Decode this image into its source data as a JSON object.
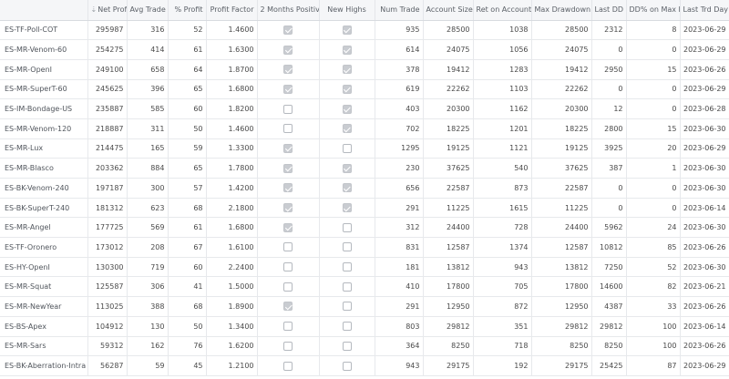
{
  "columns": [
    {
      "label": "Net Profit",
      "sort": "sort-desc-icon"
    },
    {
      "label": "Avg Trade"
    },
    {
      "label": "% Profit"
    },
    {
      "label": "Profit Factor"
    },
    {
      "label": "2 Months Positive"
    },
    {
      "label": "New Highs"
    },
    {
      "label": "Num Trade"
    },
    {
      "label": "Account Size"
    },
    {
      "label": "Ret on Account"
    },
    {
      "label": "Max Drawdown"
    },
    {
      "label": "Last DD"
    },
    {
      "label": "DD% on Max DD"
    },
    {
      "label": "Last Trd Day"
    }
  ],
  "rows": [
    {
      "name": "ES-TF-Poll-COT",
      "net_profit": "295987",
      "avg_trade": "316",
      "pct_profit": "52",
      "profit_factor": "1.4600",
      "two_months_positive": true,
      "new_highs": true,
      "num_trade": "935",
      "account_size": "28500",
      "ret_on_account": "1038",
      "max_drawdown": "28500",
      "last_dd": "2312",
      "dd_pct": "8",
      "last_trd_day": "2023-06-29"
    },
    {
      "name": "ES-MR-Venom-60",
      "net_profit": "254275",
      "avg_trade": "414",
      "pct_profit": "61",
      "profit_factor": "1.6300",
      "two_months_positive": true,
      "new_highs": true,
      "num_trade": "614",
      "account_size": "24075",
      "ret_on_account": "1056",
      "max_drawdown": "24075",
      "last_dd": "0",
      "dd_pct": "0",
      "last_trd_day": "2023-06-29"
    },
    {
      "name": "ES-MR-OpenI",
      "net_profit": "249100",
      "avg_trade": "658",
      "pct_profit": "64",
      "profit_factor": "1.8700",
      "two_months_positive": true,
      "new_highs": true,
      "num_trade": "378",
      "account_size": "19412",
      "ret_on_account": "1283",
      "max_drawdown": "19412",
      "last_dd": "2950",
      "dd_pct": "15",
      "last_trd_day": "2023-06-26"
    },
    {
      "name": "ES-MR-SuperT-60",
      "net_profit": "245625",
      "avg_trade": "396",
      "pct_profit": "65",
      "profit_factor": "1.6800",
      "two_months_positive": true,
      "new_highs": true,
      "num_trade": "619",
      "account_size": "22262",
      "ret_on_account": "1103",
      "max_drawdown": "22262",
      "last_dd": "0",
      "dd_pct": "0",
      "last_trd_day": "2023-06-29"
    },
    {
      "name": "ES-IM-Bondage-US",
      "net_profit": "235887",
      "avg_trade": "585",
      "pct_profit": "60",
      "profit_factor": "1.8200",
      "two_months_positive": false,
      "new_highs": true,
      "num_trade": "403",
      "account_size": "20300",
      "ret_on_account": "1162",
      "max_drawdown": "20300",
      "last_dd": "12",
      "dd_pct": "0",
      "last_trd_day": "2023-06-28"
    },
    {
      "name": "ES-MR-Venom-120",
      "net_profit": "218887",
      "avg_trade": "311",
      "pct_profit": "50",
      "profit_factor": "1.4600",
      "two_months_positive": false,
      "new_highs": true,
      "num_trade": "702",
      "account_size": "18225",
      "ret_on_account": "1201",
      "max_drawdown": "18225",
      "last_dd": "2800",
      "dd_pct": "15",
      "last_trd_day": "2023-06-30"
    },
    {
      "name": "ES-MR-Lux",
      "net_profit": "214475",
      "avg_trade": "165",
      "pct_profit": "59",
      "profit_factor": "1.3300",
      "two_months_positive": true,
      "new_highs": false,
      "num_trade": "1295",
      "account_size": "19125",
      "ret_on_account": "1121",
      "max_drawdown": "19125",
      "last_dd": "3925",
      "dd_pct": "20",
      "last_trd_day": "2023-06-29"
    },
    {
      "name": "ES-MR-Blasco",
      "net_profit": "203362",
      "avg_trade": "884",
      "pct_profit": "65",
      "profit_factor": "1.7800",
      "two_months_positive": true,
      "new_highs": true,
      "num_trade": "230",
      "account_size": "37625",
      "ret_on_account": "540",
      "max_drawdown": "37625",
      "last_dd": "387",
      "dd_pct": "1",
      "last_trd_day": "2023-06-30"
    },
    {
      "name": "ES-BK-Venom-240",
      "net_profit": "197187",
      "avg_trade": "300",
      "pct_profit": "57",
      "profit_factor": "1.4200",
      "two_months_positive": true,
      "new_highs": true,
      "num_trade": "656",
      "account_size": "22587",
      "ret_on_account": "873",
      "max_drawdown": "22587",
      "last_dd": "0",
      "dd_pct": "0",
      "last_trd_day": "2023-06-30"
    },
    {
      "name": "ES-BK-SuperT-240",
      "net_profit": "181312",
      "avg_trade": "623",
      "pct_profit": "68",
      "profit_factor": "2.1800",
      "two_months_positive": true,
      "new_highs": true,
      "num_trade": "291",
      "account_size": "11225",
      "ret_on_account": "1615",
      "max_drawdown": "11225",
      "last_dd": "0",
      "dd_pct": "0",
      "last_trd_day": "2023-06-14"
    },
    {
      "name": "ES-MR-Angel",
      "net_profit": "177725",
      "avg_trade": "569",
      "pct_profit": "61",
      "profit_factor": "1.6800",
      "two_months_positive": true,
      "new_highs": false,
      "num_trade": "312",
      "account_size": "24400",
      "ret_on_account": "728",
      "max_drawdown": "24400",
      "last_dd": "5962",
      "dd_pct": "24",
      "last_trd_day": "2023-06-30"
    },
    {
      "name": "ES-TF-Oronero",
      "net_profit": "173012",
      "avg_trade": "208",
      "pct_profit": "67",
      "profit_factor": "1.6100",
      "two_months_positive": false,
      "new_highs": false,
      "num_trade": "831",
      "account_size": "12587",
      "ret_on_account": "1374",
      "max_drawdown": "12587",
      "last_dd": "10812",
      "dd_pct": "85",
      "last_trd_day": "2023-06-26"
    },
    {
      "name": "ES-HY-OpenI",
      "net_profit": "130300",
      "avg_trade": "719",
      "pct_profit": "60",
      "profit_factor": "2.2400",
      "two_months_positive": false,
      "new_highs": false,
      "num_trade": "181",
      "account_size": "13812",
      "ret_on_account": "943",
      "max_drawdown": "13812",
      "last_dd": "7250",
      "dd_pct": "52",
      "last_trd_day": "2023-06-30"
    },
    {
      "name": "ES-MR-Squat",
      "net_profit": "125587",
      "avg_trade": "306",
      "pct_profit": "41",
      "profit_factor": "1.5000",
      "two_months_positive": false,
      "new_highs": false,
      "num_trade": "410",
      "account_size": "17800",
      "ret_on_account": "705",
      "max_drawdown": "17800",
      "last_dd": "14600",
      "dd_pct": "82",
      "last_trd_day": "2023-06-21"
    },
    {
      "name": "ES-MR-NewYear",
      "net_profit": "113025",
      "avg_trade": "388",
      "pct_profit": "68",
      "profit_factor": "1.8900",
      "two_months_positive": true,
      "new_highs": false,
      "num_trade": "291",
      "account_size": "12950",
      "ret_on_account": "872",
      "max_drawdown": "12950",
      "last_dd": "4387",
      "dd_pct": "33",
      "last_trd_day": "2023-06-26"
    },
    {
      "name": "ES-BS-Apex",
      "net_profit": "104912",
      "avg_trade": "130",
      "pct_profit": "50",
      "profit_factor": "1.3400",
      "two_months_positive": false,
      "new_highs": false,
      "num_trade": "803",
      "account_size": "29812",
      "ret_on_account": "351",
      "max_drawdown": "29812",
      "last_dd": "29812",
      "dd_pct": "100",
      "last_trd_day": "2023-06-14"
    },
    {
      "name": "ES-MR-Sars",
      "net_profit": "59312",
      "avg_trade": "162",
      "pct_profit": "76",
      "profit_factor": "1.6200",
      "two_months_positive": false,
      "new_highs": false,
      "num_trade": "364",
      "account_size": "8250",
      "ret_on_account": "718",
      "max_drawdown": "8250",
      "last_dd": "8250",
      "dd_pct": "100",
      "last_trd_day": "2023-06-26"
    },
    {
      "name": "ES-BK-Aberration-Intra",
      "net_profit": "56287",
      "avg_trade": "59",
      "pct_profit": "45",
      "profit_factor": "1.2100",
      "two_months_positive": false,
      "new_highs": false,
      "num_trade": "943",
      "account_size": "29175",
      "ret_on_account": "192",
      "max_drawdown": "29175",
      "last_dd": "25425",
      "dd_pct": "87",
      "last_trd_day": "2023-06-29"
    }
  ]
}
